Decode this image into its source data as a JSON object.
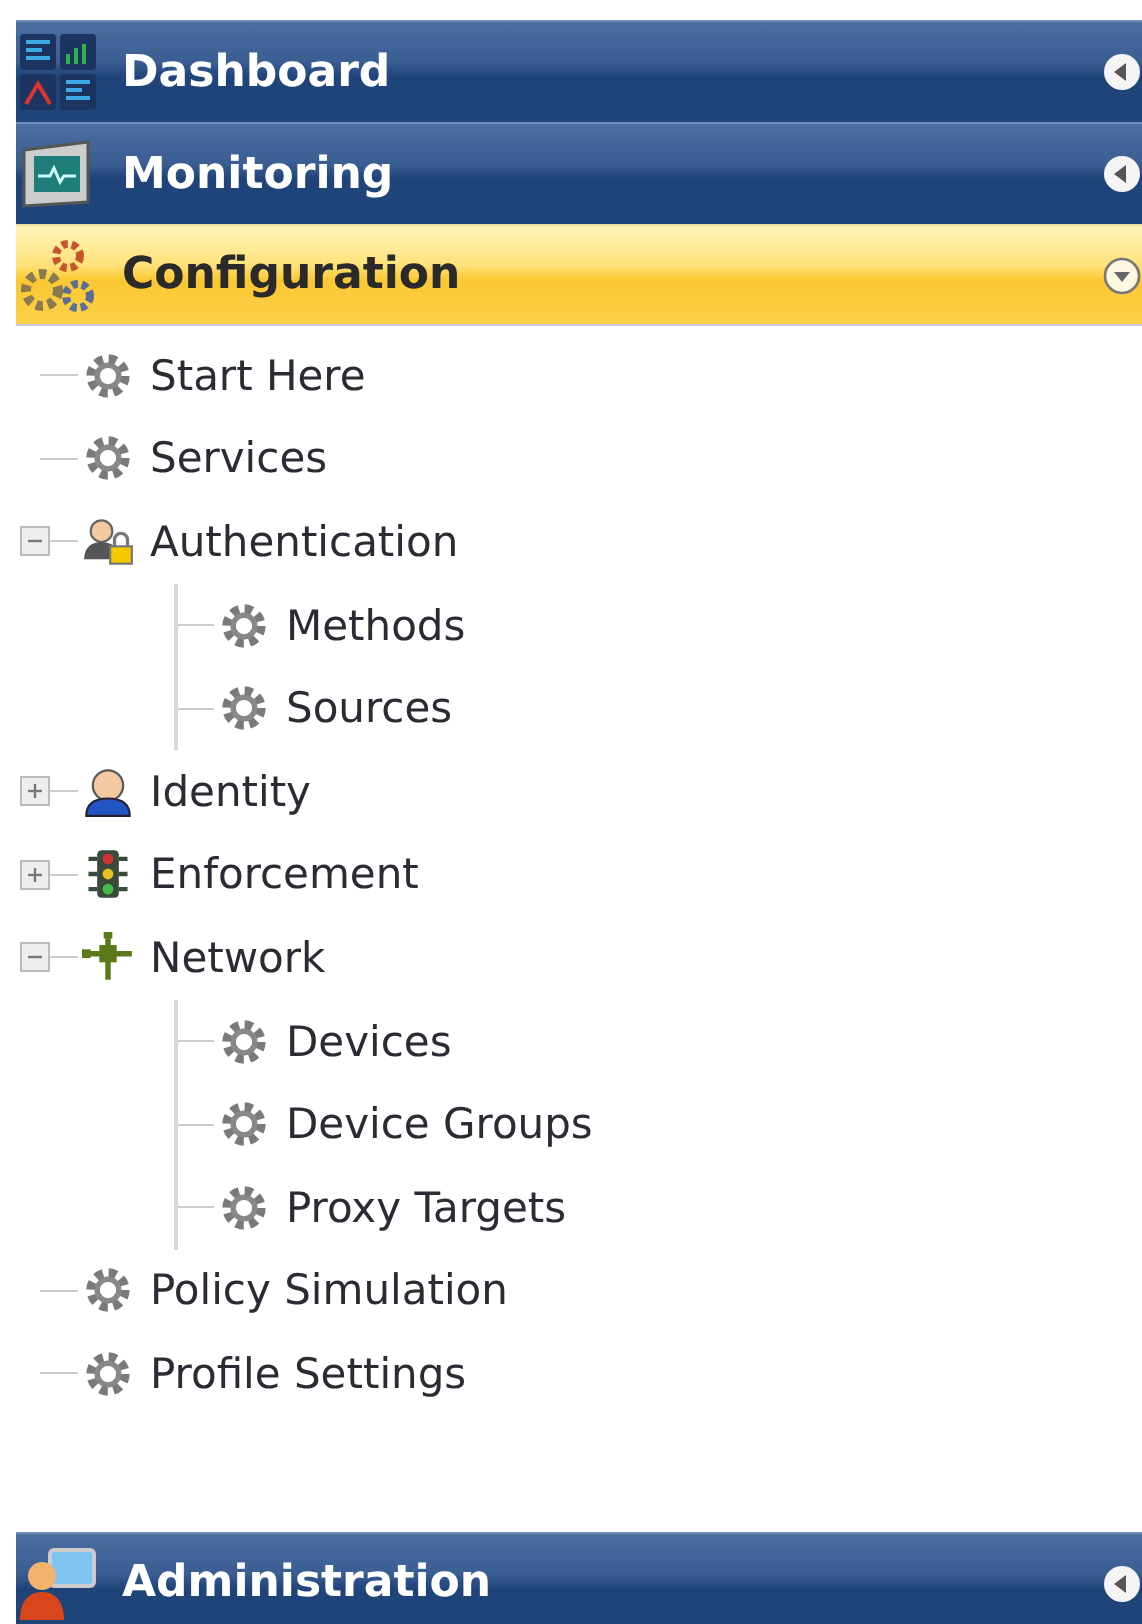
{
  "sections": [
    {
      "label": "Dashboard",
      "expanded": false
    },
    {
      "label": "Monitoring",
      "expanded": false
    },
    {
      "label": "Configuration",
      "expanded": true,
      "tree": [
        {
          "label": "Start Here",
          "kind": "leaf"
        },
        {
          "label": "Services",
          "kind": "leaf"
        },
        {
          "label": "Authentication",
          "kind": "group",
          "expanded": true,
          "children": [
            {
              "label": "Methods"
            },
            {
              "label": "Sources"
            }
          ]
        },
        {
          "label": "Identity",
          "kind": "group",
          "expanded": false
        },
        {
          "label": "Enforcement",
          "kind": "group",
          "expanded": false
        },
        {
          "label": "Network",
          "kind": "group",
          "expanded": true,
          "children": [
            {
              "label": "Devices"
            },
            {
              "label": "Device Groups"
            },
            {
              "label": "Proxy Targets"
            }
          ]
        },
        {
          "label": "Policy Simulation",
          "kind": "leaf"
        },
        {
          "label": "Profile Settings",
          "kind": "leaf"
        }
      ]
    },
    {
      "label": "Administration",
      "expanded": false
    }
  ]
}
